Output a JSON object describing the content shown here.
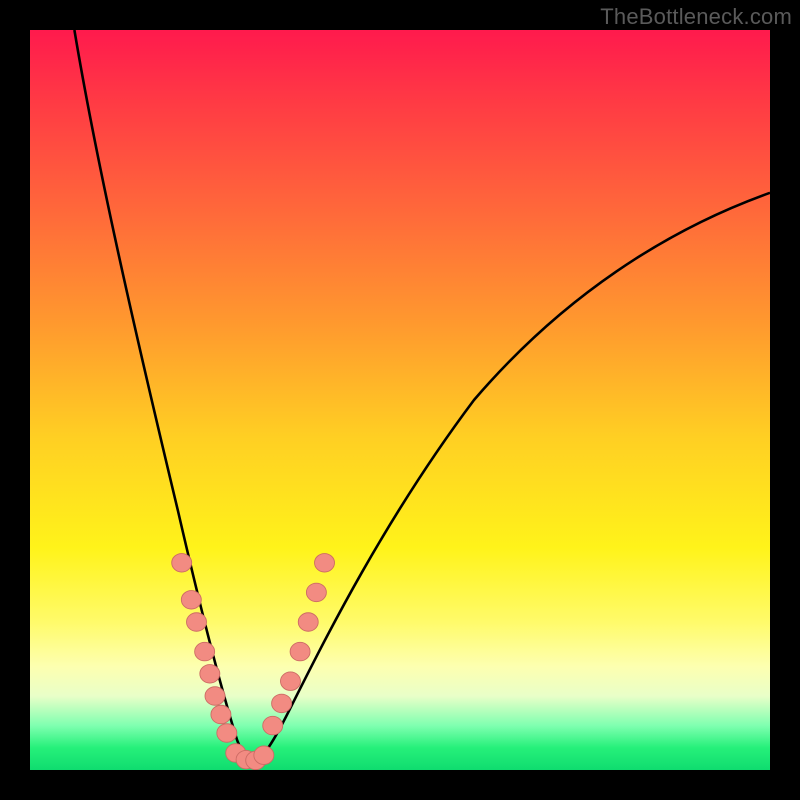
{
  "watermark": "TheBottleneck.com",
  "colors": {
    "background": "#000000",
    "curve": "#000000",
    "marker_fill": "#f28b82",
    "marker_stroke": "#cc6b64",
    "gradient_stops": [
      "#ff1a4d",
      "#ff3b44",
      "#ff6a3a",
      "#ff9a2e",
      "#ffcf23",
      "#fff31a",
      "#fffb6a",
      "#fdffb0",
      "#e9ffc8",
      "#7fffb0",
      "#26f07a",
      "#0fdc6f"
    ]
  },
  "chart_data": {
    "type": "line",
    "title": "",
    "xlabel": "",
    "ylabel": "",
    "xlim": [
      0,
      100
    ],
    "ylim": [
      0,
      100
    ],
    "grid": false,
    "annotations": [
      "TheBottleneck.com"
    ],
    "series": [
      {
        "name": "left_curve",
        "x": [
          6,
          8,
          10,
          12,
          14,
          16,
          18,
          20,
          22,
          23.5,
          25,
          26,
          27,
          28,
          29,
          30
        ],
        "y": [
          100,
          87,
          75,
          64,
          53,
          43,
          34,
          26,
          18,
          13,
          9,
          6,
          4,
          2.5,
          1.5,
          1
        ]
      },
      {
        "name": "right_curve",
        "x": [
          30,
          32,
          35,
          38,
          42,
          46,
          50,
          55,
          60,
          66,
          72,
          78,
          85,
          92,
          100
        ],
        "y": [
          1,
          3,
          8,
          14,
          22,
          30,
          37,
          44,
          50,
          56,
          61,
          65,
          70,
          74,
          78
        ]
      },
      {
        "name": "markers_left",
        "x": [
          20.5,
          21.8,
          22.5,
          23.6,
          24.3,
          25.0,
          25.8,
          26.6
        ],
        "y": [
          28,
          23,
          20,
          16,
          13,
          10,
          7.5,
          5
        ]
      },
      {
        "name": "markers_right",
        "x": [
          32.8,
          34.0,
          35.2,
          36.5,
          37.6,
          38.7,
          39.8
        ],
        "y": [
          6,
          9,
          12,
          16,
          20,
          24,
          28
        ]
      },
      {
        "name": "markers_bottom",
        "x": [
          27.8,
          29.2,
          30.5,
          31.6
        ],
        "y": [
          2.3,
          1.4,
          1.3,
          2.0
        ]
      }
    ]
  }
}
